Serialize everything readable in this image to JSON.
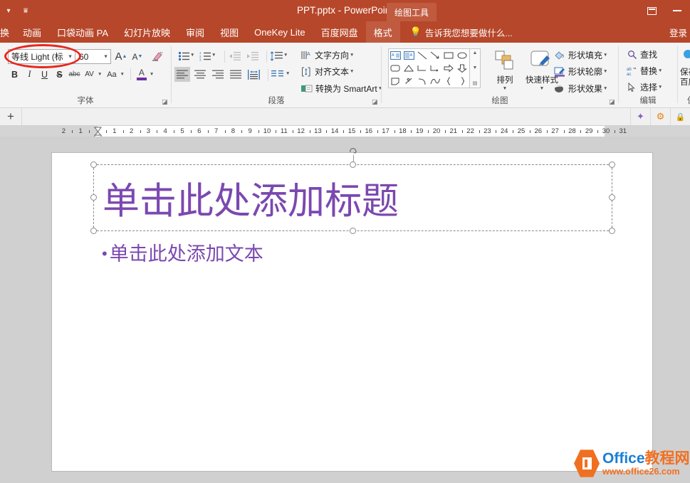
{
  "titlebar": {
    "document_title": "PPT.pptx - PowerPoint",
    "qat": [
      {
        "name": "qat-dropdown",
        "glyph": "▾"
      },
      {
        "name": "qat-customize",
        "glyph": "⩸"
      }
    ],
    "ribbon_display_options": "",
    "minimize": "",
    "signin_label": "登录"
  },
  "contextual": {
    "group_label": "绘图工具"
  },
  "tabs": [
    {
      "label": "换",
      "partial": true,
      "active": false
    },
    {
      "label": "动画",
      "partial": false,
      "active": false
    },
    {
      "label": "口袋动画 PA",
      "partial": false,
      "active": false
    },
    {
      "label": "幻灯片放映",
      "partial": false,
      "active": false
    },
    {
      "label": "审阅",
      "partial": false,
      "active": false
    },
    {
      "label": "视图",
      "partial": false,
      "active": false
    },
    {
      "label": "OneKey Lite",
      "partial": false,
      "active": false
    },
    {
      "label": "百度网盘",
      "partial": false,
      "active": false
    },
    {
      "label": "格式",
      "partial": false,
      "active": true
    }
  ],
  "tell_me": {
    "placeholder": "告诉我您想要做什么...",
    "icon": "lightbulb-icon"
  },
  "ribbon": {
    "font_group": {
      "label": "字体",
      "font_name": "等线 Light (标",
      "font_size": "60",
      "grow_font": "A",
      "shrink_font": "A",
      "clear_formatting": "clear-formatting-icon",
      "bold": "B",
      "italic": "I",
      "underline": "U",
      "strikethrough": "S",
      "text_shadow": "abc",
      "character_spacing": "AV",
      "change_case": "Aa",
      "font_color": "A",
      "font_color_swatch": "#7030a0"
    },
    "paragraph_group": {
      "label": "段落",
      "bullets": "bullets-icon",
      "numbering": "numbering-icon",
      "decrease_indent": "decrease-indent-icon",
      "increase_indent": "increase-indent-icon",
      "line_spacing": "line-spacing-icon",
      "align_left": "align-left-icon",
      "align_center": "align-center-icon",
      "align_right": "align-right-icon",
      "justify": "justify-icon",
      "columns": "columns-icon",
      "text_direction": "文字方向",
      "align_text": "对齐文本",
      "convert_smartart": "转换为 SmartArt"
    },
    "drawing_group": {
      "label": "绘图",
      "shapes": [
        "textbox-shape",
        "vertical-textbox-shape",
        "line-shape",
        "arrow-shape",
        "rectangle-shape",
        "oval-shape",
        "rounded-rect-shape",
        "triangle-shape",
        "elbow-connector-shape",
        "elbow-arrow-connector-shape",
        "right-arrow-shape",
        "down-arrow-shape",
        "folded-corner-shape",
        "freeform-shape",
        "arc-shape",
        "curve-shape",
        "left-brace-shape",
        "right-brace-shape"
      ],
      "arrange": "排列",
      "quick_styles": "快速样式",
      "shape_fill": "形状填充",
      "shape_outline": "形状轮廓",
      "shape_effects": "形状效果"
    },
    "editing_group": {
      "label": "编辑",
      "find": "查找",
      "replace": "替换",
      "select": "选择"
    },
    "baidu_group": {
      "label_line1": "保存到",
      "label_line2": "百度网盘",
      "group_label": "保存"
    }
  },
  "toolbar2": {
    "add_slide": "+",
    "icons": [
      {
        "name": "effects-icon",
        "glyph": "✦"
      },
      {
        "name": "settings-gear-icon",
        "glyph": "⚙"
      },
      {
        "name": "lock-icon",
        "glyph": "🔒"
      }
    ]
  },
  "ruler": {
    "left_labels": [
      "2",
      "1"
    ],
    "labels": [
      "1",
      "2",
      "3",
      "4",
      "5",
      "6",
      "7",
      "8",
      "9",
      "10",
      "11",
      "12",
      "13",
      "14",
      "15",
      "16",
      "17",
      "18",
      "19",
      "20",
      "21",
      "22",
      "23",
      "24",
      "25",
      "26",
      "27",
      "28",
      "29",
      "30",
      "31"
    ],
    "inactive_right_from": "29"
  },
  "slide": {
    "title_placeholder": "单击此处添加标题",
    "body_placeholder": "单击此处添加文本",
    "bullet_glyph": "•",
    "title_color": "#7b48b0",
    "body_color": "#7b48b0"
  },
  "annotation": {
    "type": "red-ellipse",
    "color": "#e8271e",
    "target": "font-name-box"
  },
  "watermark": {
    "brand_en": "Office",
    "brand_cn": "教程网",
    "url": "www.office26.com"
  }
}
